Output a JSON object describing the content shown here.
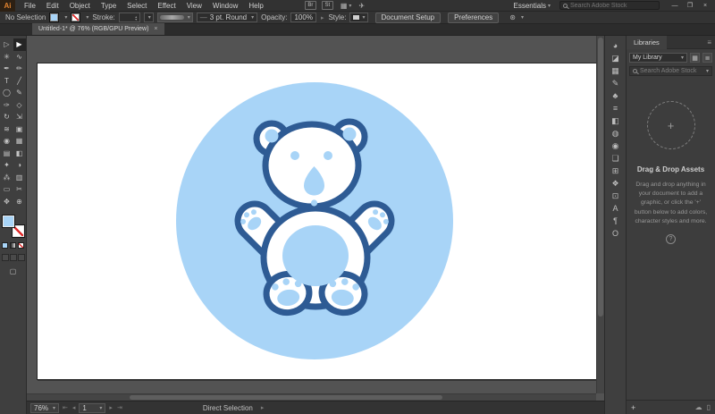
{
  "menu_bar": {
    "logo": "Ai",
    "menus": [
      "File",
      "Edit",
      "Object",
      "Type",
      "Select",
      "Effect",
      "View",
      "Window",
      "Help"
    ],
    "badges": [
      {
        "name": "bridge-badge",
        "glyph": "Br"
      },
      {
        "name": "stock-badge",
        "glyph": "St"
      }
    ],
    "arrange_documents_glyph": "▦",
    "gpu_performance_glyph": "✈",
    "workspace_label": "Essentials",
    "search_placeholder": "Search Adobe Stock",
    "window_minimize": "—",
    "window_restore": "❐",
    "window_close": "×"
  },
  "control_bar": {
    "selection_label": "No Selection",
    "stroke_label": "Stroke:",
    "brush_prefix": "—",
    "brush_name": "3 pt. Round",
    "opacity_label": "Opacity:",
    "opacity_value": "100%",
    "style_label": "Style:",
    "document_setup_label": "Document Setup",
    "preferences_label": "Preferences",
    "select_similar_glyph": "⊛"
  },
  "document_tab": {
    "title": "Untitled-1* @ 76% (RGB/GPU Preview)",
    "close_glyph": "×"
  },
  "toolbar": {
    "tools": [
      {
        "name": "selection-tool",
        "glyph": "▷"
      },
      {
        "name": "direct-selection-tool",
        "glyph": "▶",
        "selected": true
      },
      {
        "name": "magic-wand-tool",
        "glyph": "✳"
      },
      {
        "name": "lasso-tool",
        "glyph": "∿"
      },
      {
        "name": "pen-tool",
        "glyph": "✒"
      },
      {
        "name": "curvature-tool",
        "glyph": "✏"
      },
      {
        "name": "type-tool",
        "glyph": "T"
      },
      {
        "name": "line-segment-tool",
        "glyph": "╱"
      },
      {
        "name": "ellipse-tool",
        "glyph": "◯"
      },
      {
        "name": "paintbrush-tool",
        "glyph": "✎"
      },
      {
        "name": "pencil-tool",
        "glyph": "✑"
      },
      {
        "name": "eraser-tool",
        "glyph": "◇"
      },
      {
        "name": "rotate-tool",
        "glyph": "↻"
      },
      {
        "name": "scale-tool",
        "glyph": "⇲"
      },
      {
        "name": "width-tool",
        "glyph": "≋"
      },
      {
        "name": "free-transform-tool",
        "glyph": "▣"
      },
      {
        "name": "shape-builder-tool",
        "glyph": "◉"
      },
      {
        "name": "perspective-grid-tool",
        "glyph": "▦"
      },
      {
        "name": "mesh-tool",
        "glyph": "▤"
      },
      {
        "name": "gradient-tool",
        "glyph": "◧"
      },
      {
        "name": "eyedropper-tool",
        "glyph": "✦"
      },
      {
        "name": "blend-tool",
        "glyph": "◑"
      },
      {
        "name": "symbol-sprayer-tool",
        "glyph": "⁂"
      },
      {
        "name": "column-graph-tool",
        "glyph": "▥"
      },
      {
        "name": "artboard-tool",
        "glyph": "▭"
      },
      {
        "name": "slice-tool",
        "glyph": "✂"
      },
      {
        "name": "hand-tool",
        "glyph": "✥"
      },
      {
        "name": "zoom-tool",
        "glyph": "⊕"
      }
    ]
  },
  "right_dock": {
    "panel_icons": [
      {
        "name": "color-panel-icon",
        "glyph": "◕"
      },
      {
        "name": "color-guide-panel-icon",
        "glyph": "◪"
      },
      {
        "name": "swatches-panel-icon",
        "glyph": "▦"
      },
      {
        "name": "brushes-panel-icon",
        "glyph": "✎"
      },
      {
        "name": "symbols-panel-icon",
        "glyph": "♣"
      },
      {
        "name": "stroke-panel-icon",
        "glyph": "≡"
      },
      {
        "name": "gradient-panel-icon",
        "glyph": "◧"
      },
      {
        "name": "transparency-panel-icon",
        "glyph": "◍"
      },
      {
        "name": "appearance-panel-icon",
        "glyph": "◉"
      },
      {
        "name": "graphic-styles-panel-icon",
        "glyph": "❏"
      },
      {
        "name": "links-panel-icon",
        "glyph": "⊞"
      },
      {
        "name": "layers-panel-icon",
        "glyph": "❖"
      },
      {
        "name": "artboards-panel-icon",
        "glyph": "⊡"
      },
      {
        "name": "character-panel-icon",
        "glyph": "A"
      },
      {
        "name": "paragraph-panel-icon",
        "glyph": "¶"
      },
      {
        "name": "opentype-panel-icon",
        "glyph": "O"
      }
    ]
  },
  "libraries_panel": {
    "title": "Libraries",
    "menu_glyph": "≡",
    "library_name": "My Library",
    "grid_view_glyph": "▦",
    "list_view_glyph": "≣",
    "search_placeholder": "Search Adobe Stock",
    "empty_title": "Drag & Drop Assets",
    "empty_text": "Drag and drop anything in your document to add a graphic, or click the '+' button below to add colors, character styles and more.",
    "drop_plus": "+",
    "help_glyph": "?",
    "add_button": "+",
    "cloud_glyph": "☁",
    "delete_glyph": "▯"
  },
  "status_bar": {
    "zoom_value": "76%",
    "first_glyph": "⇤",
    "prev_glyph": "◂",
    "artboard_number": "1",
    "next_glyph": "▸",
    "last_glyph": "⇥",
    "status_text": "Direct Selection",
    "flyout_glyph": "▸"
  },
  "canvas": {
    "artwork": "teddy-bear-icon-on-blue-circle",
    "colors": {
      "circle": "#A8D4F7",
      "outline": "#2E5B94",
      "detail": "#A8D4F7",
      "white": "#FFFFFF"
    }
  }
}
